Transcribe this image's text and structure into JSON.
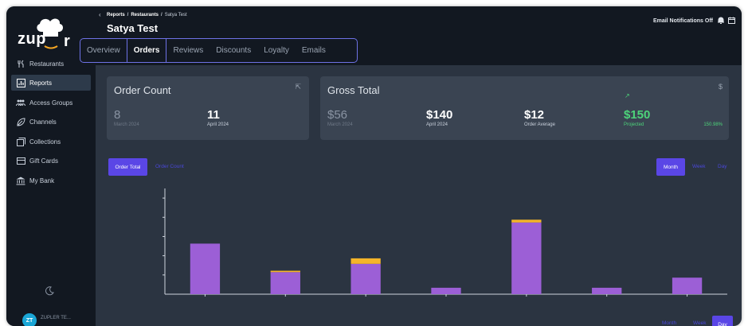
{
  "brand": {
    "logo_text": "zup"
  },
  "sidebar": {
    "items": [
      {
        "label": "Restaurants",
        "icon": "fork-knife-icon"
      },
      {
        "label": "Reports",
        "icon": "report-icon"
      },
      {
        "label": "Access Groups",
        "icon": "users-icon"
      },
      {
        "label": "Channels",
        "icon": "leaf-icon"
      },
      {
        "label": "Collections",
        "icon": "collections-icon"
      },
      {
        "label": "Gift Cards",
        "icon": "gift-card-icon"
      },
      {
        "label": "My Bank",
        "icon": "bank-icon"
      }
    ],
    "active_index": 1,
    "user_initials": "ZT",
    "user_name": "ZUPLER TE..."
  },
  "header": {
    "breadcrumb": [
      "Reports",
      "Restaurants",
      "Satya Test"
    ],
    "title": "Satya Test",
    "notification_status": "Email Notifications Off"
  },
  "tabs": [
    "Overview",
    "Orders",
    "Reviews",
    "Discounts",
    "Loyalty",
    "Emails"
  ],
  "active_tab": 1,
  "order_count": {
    "title": "Order Count",
    "prev_value": "8",
    "prev_label": "March 2024",
    "cur_value": "11",
    "cur_label": "April 2024"
  },
  "gross_total": {
    "title": "Gross Total",
    "prev_value": "$56",
    "prev_label": "March 2024",
    "cur_value": "$140",
    "cur_label": "April 2024",
    "avg_value": "$12",
    "avg_label": "Order Average",
    "proj_value": "$150",
    "proj_label": "Projected",
    "proj_pct": "150.98%",
    "currency_symbol": "$"
  },
  "chart_controls": {
    "metric_active": "Order Total",
    "metric_other": "Order Count",
    "period_active": "Month",
    "period_week": "Week",
    "period_day": "Day",
    "bottom_month": "Month",
    "bottom_week": "Week",
    "bottom_day": "Day"
  },
  "colors": {
    "bar_main": "#9c5fd6",
    "bar_top": "#f5b52a",
    "accent": "#5a46e6",
    "positive": "#4dd47a"
  },
  "chart_data": {
    "type": "bar",
    "stacked": true,
    "categories": [
      "",
      "",
      "",
      "",
      "",
      "",
      ""
    ],
    "series": [
      {
        "values": [
          55,
          24,
          33,
          7,
          78,
          7,
          18
        ]
      },
      {
        "values": [
          0,
          1.5,
          6,
          0,
          3,
          0,
          0
        ]
      }
    ],
    "ylim": [
      0,
      115
    ],
    "grid": false
  }
}
